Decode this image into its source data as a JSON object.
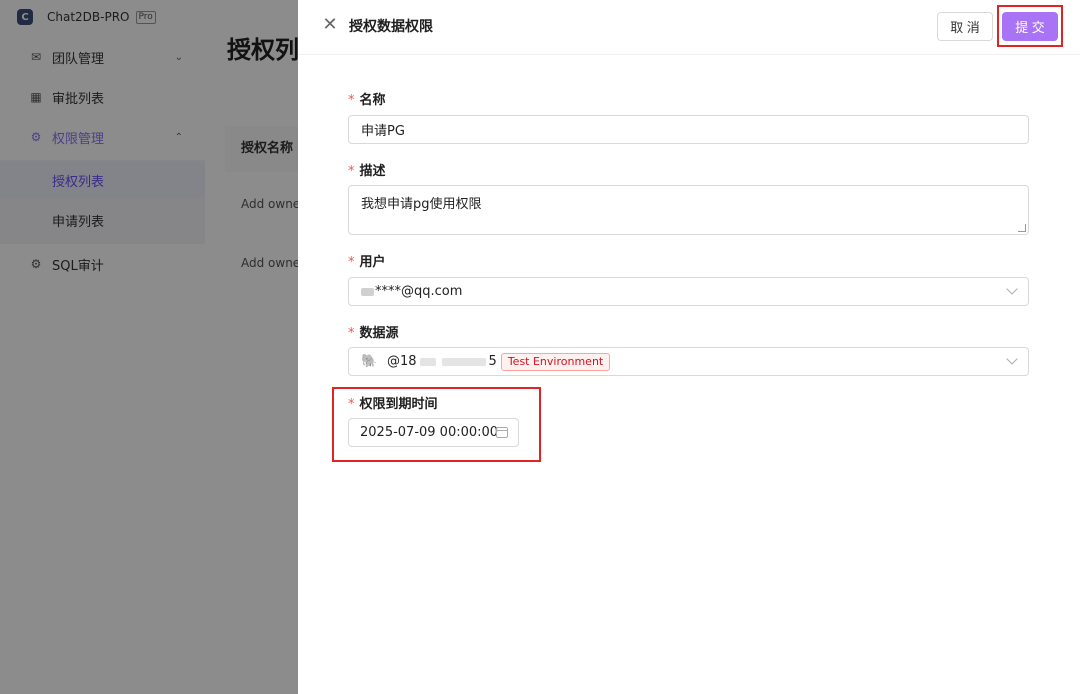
{
  "app": {
    "logo_letter": "C",
    "name": "Chat2DB-PRO",
    "tag": "Pro"
  },
  "sidebar": {
    "items": [
      {
        "icon": "✉",
        "label": "团队管理",
        "chevron": "⌄"
      },
      {
        "icon": "▦",
        "label": "审批列表"
      },
      {
        "icon": "⚙",
        "label": "权限管理",
        "chevron": "⌃"
      },
      {
        "label": "授权列表"
      },
      {
        "label": "申请列表"
      },
      {
        "icon": "⚙",
        "label": "SQL审计"
      }
    ]
  },
  "main": {
    "title": "授权列",
    "table_header": "授权名称",
    "rows": [
      "Add owner",
      "Add owner"
    ]
  },
  "drawer": {
    "close_glyph": "✕",
    "title": "授权数据权限",
    "cancel_label": "取 消",
    "submit_label": "提 交",
    "required_mark": "*",
    "fields": {
      "name_label": "名称",
      "name_value": "申请PG",
      "desc_label": "描述",
      "desc_value": "我想申请pg使用权限",
      "user_label": "用户",
      "user_value": "****@qq.com",
      "datasource_label": "数据源",
      "datasource_prefix": "@18",
      "datasource_suffix": "5",
      "datasource_tag": "Test Environment",
      "expire_label": "权限到期时间",
      "expire_value": "2025-07-09 00:00:00"
    }
  },
  "colors": {
    "accent": "#a874f5",
    "highlight_box": "#e02424",
    "required": "#ff4d4f",
    "tag_text": "#cf1322"
  }
}
